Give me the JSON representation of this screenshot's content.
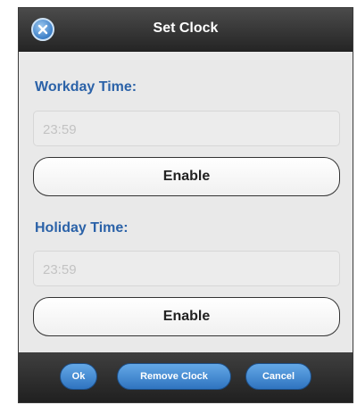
{
  "dialog": {
    "title": "Set Clock",
    "close_icon": "close-circle-icon"
  },
  "workday": {
    "label": "Workday Time:",
    "placeholder": "23:59",
    "enable_label": "Enable"
  },
  "holiday": {
    "label": "Holiday Time:",
    "placeholder": "23:59",
    "enable_label": "Enable"
  },
  "footer": {
    "ok_label": "Ok",
    "remove_label": "Remove Clock",
    "cancel_label": "Cancel"
  }
}
